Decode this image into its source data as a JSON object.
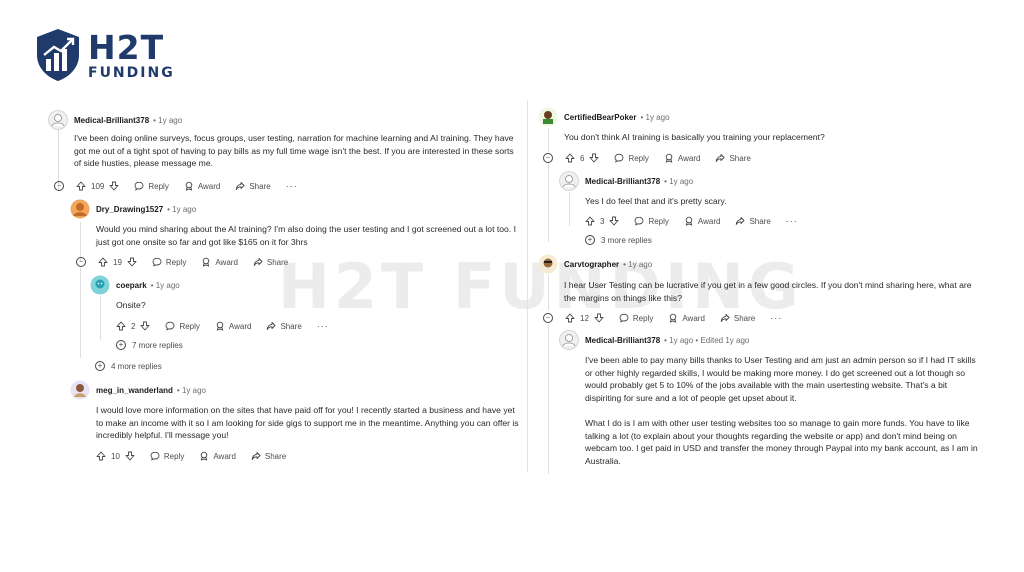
{
  "brand": {
    "title": "H2T",
    "subtitle": "FUNDING",
    "watermark": "H2T FUNDING",
    "color": "#1f3a6b"
  },
  "actions": {
    "reply": "Reply",
    "award": "Award",
    "share": "Share",
    "more": "···"
  },
  "left": {
    "c1": {
      "user": "Medical-Brilliant378",
      "age": "• 1y ago",
      "body": "I've been doing online surveys, focus groups, user testing, narration for machine learning and AI training. They have got me out of a tight spot of having to pay bills as my full time wage isn't the best. If you are interested in these sorts of side husties, please message me.",
      "votes": "109"
    },
    "c2": {
      "user": "Dry_Drawing1527",
      "age": "• 1y ago",
      "body": "Would you mind sharing about the AI training? I'm also doing the user testing and I got screened out a lot too. I just got one onsite so far and got like $165 on it for 3hrs",
      "votes": "19"
    },
    "c3": {
      "user": "coepark",
      "age": "• 1y ago",
      "body": "Onsite?",
      "votes": "2",
      "more": "7 more replies"
    },
    "more_c2": "4 more replies",
    "c4": {
      "user": "meg_in_wanderland",
      "age": "• 1y ago",
      "body": "I would love more information on the sites that have paid off for you! I recently started a business and have yet to make an income with it so I am looking for side gigs to support me in the meantime. Anything you can offer is incredibly helpful. I'll message you!",
      "votes": "10"
    }
  },
  "right": {
    "c1": {
      "user": "CertifiedBearPoker",
      "age": "• 1y ago",
      "body": "You don't think AI training is basically you training your replacement?",
      "votes": "6"
    },
    "c2": {
      "user": "Medical-Brilliant378",
      "age": "• 1y ago",
      "body": "Yes I do feel that and it's pretty scary.",
      "votes": "3",
      "more": "3 more replies"
    },
    "c3": {
      "user": "Carvtographer",
      "age": "• 1y ago",
      "body": "I hear User Testing can be lucrative if you get in a few good circles. If you don't mind sharing here, what are the margins on things like this?",
      "votes": "12"
    },
    "c4": {
      "user": "Medical-Brilliant378",
      "age": "• 1y ago • Edited 1y ago",
      "body1": "I've been able to pay many bills thanks to User Testing and am just an admin person so if I had IT skills or other highly regarded skills, I would be making more money. I do get screened out a lot though so would probably get 5 to 10% of the jobs available with the main usertesting website. That's a bit dispiriting for sure and a lot of people get upset about it.",
      "body2": "What I do is I am with other user testing websites too so manage to gain more funds. You have to like talking a lot (to explain about your thoughts regarding the website or app) and don't mind being on webcam too. I get paid in USD and transfer the money through Paypal into my bank account, as I am in Australia."
    }
  }
}
